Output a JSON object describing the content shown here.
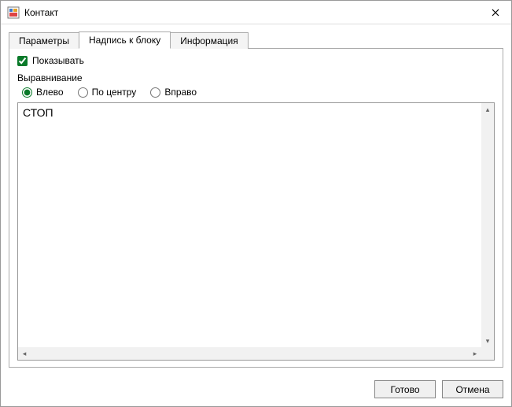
{
  "window": {
    "title": "Контакт"
  },
  "tabs": {
    "params": "Параметры",
    "label_block": "Надпись к блоку",
    "info": "Информация",
    "active": "label_block"
  },
  "panel": {
    "show_checkbox_label": "Показывать",
    "show_checked": true,
    "align_label": "Выравнивание",
    "align": {
      "left": "Влево",
      "center": "По центру",
      "right": "Вправо",
      "selected": "left"
    },
    "text_value": "СТОП"
  },
  "buttons": {
    "ok": "Готово",
    "cancel": "Отмена"
  }
}
